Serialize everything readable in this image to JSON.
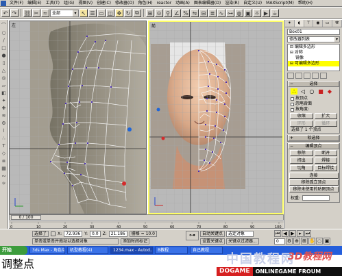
{
  "menubar": {
    "items": [
      "文件(F)",
      "编辑(E)",
      "工具(T)",
      "组(G)",
      "视图(V)",
      "创建(C)",
      "修改器(O)",
      "角色(H)",
      "reactor",
      "动画(A)",
      "图表编辑器(D)",
      "渲染(R)",
      "自定义(U)",
      "MAXScript(M)",
      "帮助(H)"
    ]
  },
  "toolbar": {
    "selection_filter": "全部",
    "icons": [
      "undo-icon",
      "redo-icon",
      "link-icon",
      "unlink-icon",
      "bind-icon",
      "select-icon",
      "select-by-name-icon",
      "region-icon",
      "move-icon",
      "rotate-icon",
      "scale-icon",
      "reference-icon",
      "pivot-icon",
      "snap-icon",
      "angle-snap-icon",
      "mirror-icon",
      "align-icon",
      "layer-icon",
      "curve-icon",
      "schematic-icon",
      "material-icon",
      "render-setup-icon",
      "render-icon",
      "quick-render-icon",
      "teapot-icon"
    ]
  },
  "viewports": {
    "left": {
      "label": "左"
    },
    "right": {
      "label": "前"
    }
  },
  "timeslider": {
    "label": "0 / 100"
  },
  "trackbar": {
    "ticks": [
      "0",
      "10",
      "20",
      "30",
      "40",
      "50",
      "60",
      "70",
      "80",
      "90",
      "100"
    ]
  },
  "command_panel": {
    "tabs": [
      "创建",
      "修改",
      "层次",
      "运动",
      "显示",
      "工具"
    ],
    "object_name": "Box01",
    "modifier_list": "修改器列表",
    "stack": [
      {
        "label": "⊟ 编辑多边形",
        "indent": false,
        "selected": false
      },
      {
        "label": "⊟ 对称",
        "indent": false,
        "selected": false
      },
      {
        "label": "镜像",
        "indent": true,
        "selected": false
      },
      {
        "label": "⊟ 可编辑多边形",
        "indent": false,
        "selected": true
      }
    ],
    "selection": {
      "title": "选择",
      "by_vertex": "按顶点",
      "ignore_backfacing": "忽略背面",
      "by_angle": "按角度:",
      "shrink": "收缩",
      "grow": "扩大",
      "ring": "环形",
      "loop": "循环",
      "status": "选择了 1 个顶点"
    },
    "soft_selection": {
      "title": "软选择"
    },
    "edit_vertices": {
      "title": "编辑顶点",
      "buttons": [
        "移除",
        "断开",
        "挤出",
        "焊接",
        "切角",
        "目标焊接",
        "连接"
      ],
      "remove_isolated": "移除孤立顶点",
      "remove_unused_map": "移除未使用的贴图顶点",
      "weight_label": "权重:"
    }
  },
  "statusbar": {
    "selected": "选择了",
    "hint": "单击或单击并拖动以选择对象",
    "x_label": "X:",
    "x_value": "72.936",
    "y_label": "Y:",
    "y_value": "0.0",
    "z_label": "Z:",
    "z_value": "21.186",
    "grid": "栅格 = 10.0",
    "add_time_tag": "添加时间标记",
    "auto_key": "自动关键点",
    "selected_obj": "选定对象",
    "set_key": "设置关键点",
    "key_filters": "关键点过滤器...",
    "frame": "0"
  },
  "taskbar": {
    "start": "开始",
    "tasks": [
      "3ds Max - 角色动画",
      "机型教程(4)",
      "1234.max - Autod...",
      "B教程",
      "自己教程"
    ]
  },
  "caption": "调整点",
  "watermark": {
    "cn": "中国教程网",
    "logo": "3D教程网",
    "dogame": "DOGAME",
    "forum": "ONLINEGAME FROUM"
  }
}
